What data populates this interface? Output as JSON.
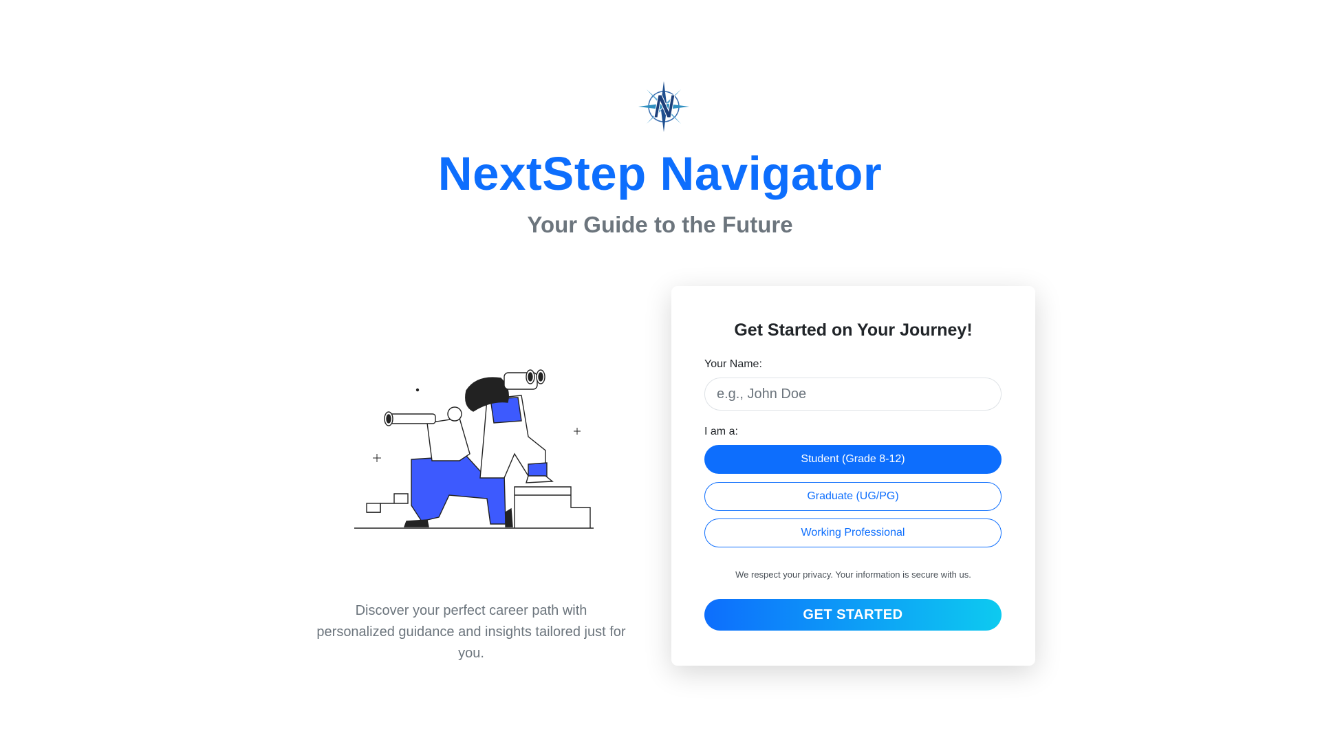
{
  "brand": {
    "title": "NextStep Navigator",
    "subtitle": "Your Guide to the Future",
    "logo_icon": "compass-n-logo"
  },
  "hero": {
    "illustration": "explorers-with-binoculars-illustration",
    "tagline": "Discover your perfect career path with personalized guidance and insights tailored just for you."
  },
  "form": {
    "title": "Get Started on Your Journey!",
    "name_label": "Your Name:",
    "name_placeholder": "e.g., John Doe",
    "name_value": "",
    "role_label": "I am a:",
    "roles": [
      {
        "label": "Student (Grade 8-12)",
        "selected": true
      },
      {
        "label": "Graduate (UG/PG)",
        "selected": false
      },
      {
        "label": "Working Professional",
        "selected": false
      }
    ],
    "privacy_note": "We respect your privacy. Your information is secure with us.",
    "submit_label": "GET STARTED"
  },
  "colors": {
    "primary": "#0d6efd",
    "accent": "#0dcaf0",
    "muted": "#6c757d"
  }
}
